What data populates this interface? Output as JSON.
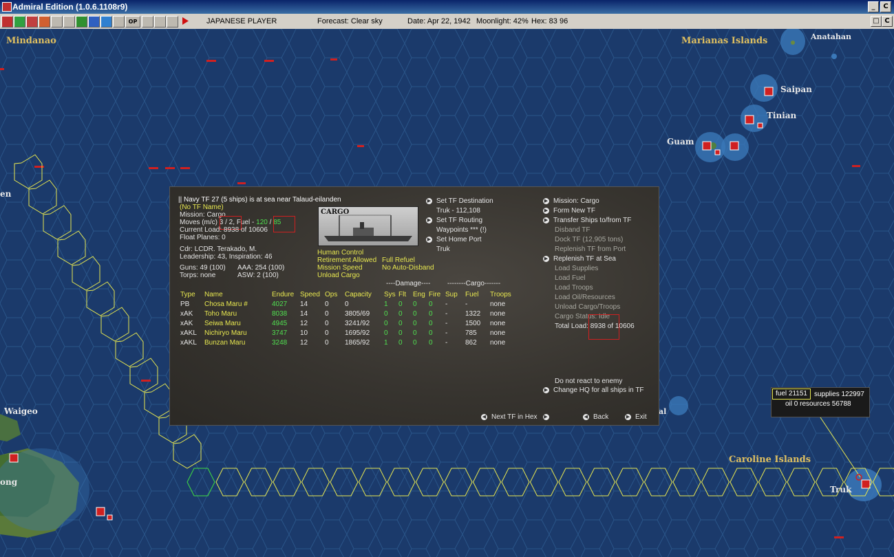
{
  "window": {
    "title": "Admiral Edition (1.0.6.1108r9)",
    "btn_min": "_",
    "btn_close": "C"
  },
  "toolbar": {
    "player": "JAPANESE PLAYER",
    "forecast": "Forecast: Clear sky",
    "date": "Date: Apr 22, 1942",
    "moonlight": "Moonlight: 42%",
    "hex": "Hex: 83 96",
    "op_label": "OP"
  },
  "map": {
    "labels": {
      "mindanao": "Mindanao",
      "marianas": "Marianas Islands",
      "anatahan": "Anatahan",
      "saipan": "Saipan",
      "tinian": "Tinian",
      "guam": "Guam",
      "en": "en",
      "waigeo": "Waigeo",
      "ong": "ong",
      "caroline": "Caroline Islands",
      "truk": "Truk",
      "al": "al"
    }
  },
  "tooltip": {
    "fuel": "fuel 21151",
    "supplies": "supplies 122997",
    "oil_res": "oil 0  resources 56788"
  },
  "tf": {
    "header": "|| Navy TF 27 (5 ships) is at sea near Talaud-eilanden",
    "name": "(No TF Name)",
    "mission": "Mission: Cargo",
    "moves_label": "Moves (m/c)",
    "moves_value": "3 / 2,",
    "fuel_label": "Fuel -",
    "fuel_a": "120",
    "fuel_sep": "/",
    "fuel_b": "85",
    "current_load": "Current Load: 8938 of 10606",
    "float_planes": "Float Planes: 0",
    "cdr": "Cdr: LCDR. Terakado, M.",
    "leadership": "Leadership: 43, Inspiration: 46",
    "guns": "Guns: 49 (100)",
    "aaa": "AAA: 254 (100)",
    "torps": "Torps: none",
    "asw": "ASW: 2 (100)",
    "image_label": "CARGO",
    "human_control": "Human Control",
    "retirement": "Retirement Allowed",
    "full_refuel": "Full Refuel",
    "mission_speed": "Mission Speed",
    "no_auto": "No Auto-Disband",
    "unload_cargo": "Unload Cargo"
  },
  "mid_menu": {
    "set_dest": "Set TF Destination",
    "dest_value": "Truk - 112,108",
    "set_routing": "Set TF Routing",
    "waypoints": "Waypoints *** (!)",
    "set_home": "Set Home Port",
    "home_value": "Truk"
  },
  "right_menu": {
    "mission": "Mission: Cargo",
    "form_new": "Form New TF",
    "transfer": "Transfer Ships to/from TF",
    "disband": "Disband TF",
    "dock": "Dock TF (12,905 tons)",
    "replenish_port": "Replenish TF from Port",
    "replenish_sea": "Replenish TF at Sea",
    "load_supplies": "Load Supplies",
    "load_fuel": "Load Fuel",
    "load_troops": "Load Troops",
    "load_oil": "Load Oil/Resources",
    "unload": "Unload Cargo/Troops",
    "cargo_status": "Cargo Status: Idle",
    "total_load": "Total Load: 8938 of 10606",
    "no_react": "Do not react to enemy",
    "change_hq": "Change HQ for all ships in TF"
  },
  "footer": {
    "next_tf": "Next TF in Hex",
    "back": "Back",
    "exit": "Exit"
  },
  "table": {
    "group_damage": "----Damage----",
    "group_cargo": "--------Cargo-------",
    "headers": [
      "Type",
      "Name",
      "Endure",
      "Speed",
      "Ops",
      "Capacity",
      "Sys",
      "Flt",
      "Eng",
      "Fire",
      "Sup",
      "Fuel",
      "Troops"
    ],
    "rows": [
      [
        "PB",
        "Chosa Maru #",
        "4027",
        "14",
        "0",
        "0",
        "1",
        "0",
        "0",
        "0",
        "-",
        "-",
        "none"
      ],
      [
        "xAK",
        "Toho Maru",
        "8038",
        "14",
        "0",
        "3805/69",
        "0",
        "0",
        "0",
        "0",
        "-",
        "1322",
        "none"
      ],
      [
        "xAK",
        "Seiwa Maru",
        "4945",
        "12",
        "0",
        "3241/92",
        "0",
        "0",
        "0",
        "0",
        "-",
        "1500",
        "none"
      ],
      [
        "xAKL",
        "Nichiryo Maru",
        "3747",
        "10",
        "0",
        "1695/92",
        "0",
        "0",
        "0",
        "0",
        "-",
        "785",
        "none"
      ],
      [
        "xAKL",
        "Bunzan Maru",
        "3248",
        "12",
        "0",
        "1865/92",
        "1",
        "0",
        "0",
        "0",
        "-",
        "862",
        "none"
      ]
    ]
  },
  "colors": {
    "ocean": "#1b3a6b",
    "hex_line": "#2c5a8f",
    "route": "#e8e850",
    "route_current": "#40e040",
    "label_gold": "#e0c060"
  }
}
